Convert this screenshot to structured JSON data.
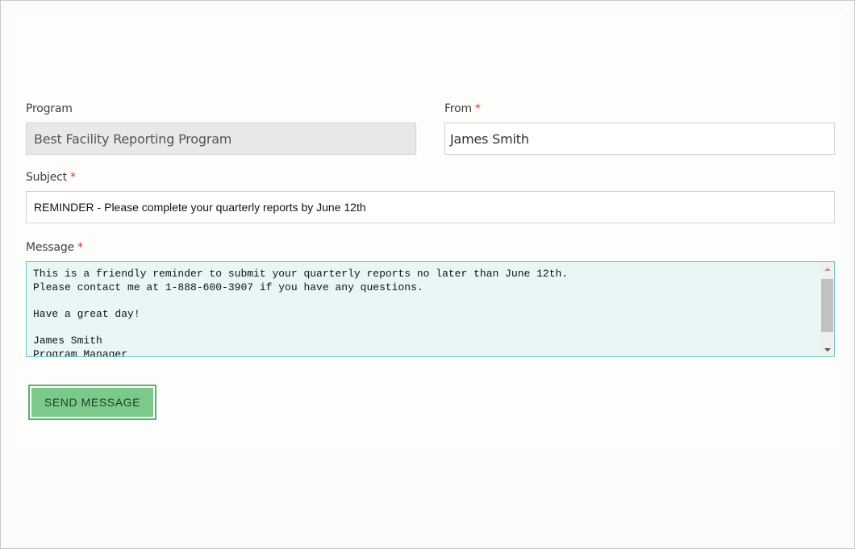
{
  "form": {
    "program": {
      "label": "Program",
      "value": "Best Facility Reporting Program"
    },
    "from": {
      "label": "From",
      "required_marker": "*",
      "value": "James Smith"
    },
    "subject": {
      "label": "Subject",
      "required_marker": "*",
      "value": "REMINDER - Please complete your quarterly reports by June 12th"
    },
    "message": {
      "label": "Message",
      "required_marker": "*",
      "value": "This is a friendly reminder to submit your quarterly reports no later than June 12th.\nPlease contact me at 1-888-600-3907 if you have any questions.\n\nHave a great day!\n\nJames Smith\nProgram Manager"
    },
    "send_button_label": "SEND MESSAGE"
  },
  "colors": {
    "required": "#e0302a",
    "message_background": "#e8f6f5",
    "message_border": "#6ccbc0",
    "send_button": "#7cc98c",
    "readonly_field": "#e8e8e8"
  },
  "icons": {
    "scroll_up": "scroll-up-arrow-icon",
    "scroll_down": "scroll-down-arrow-icon"
  }
}
